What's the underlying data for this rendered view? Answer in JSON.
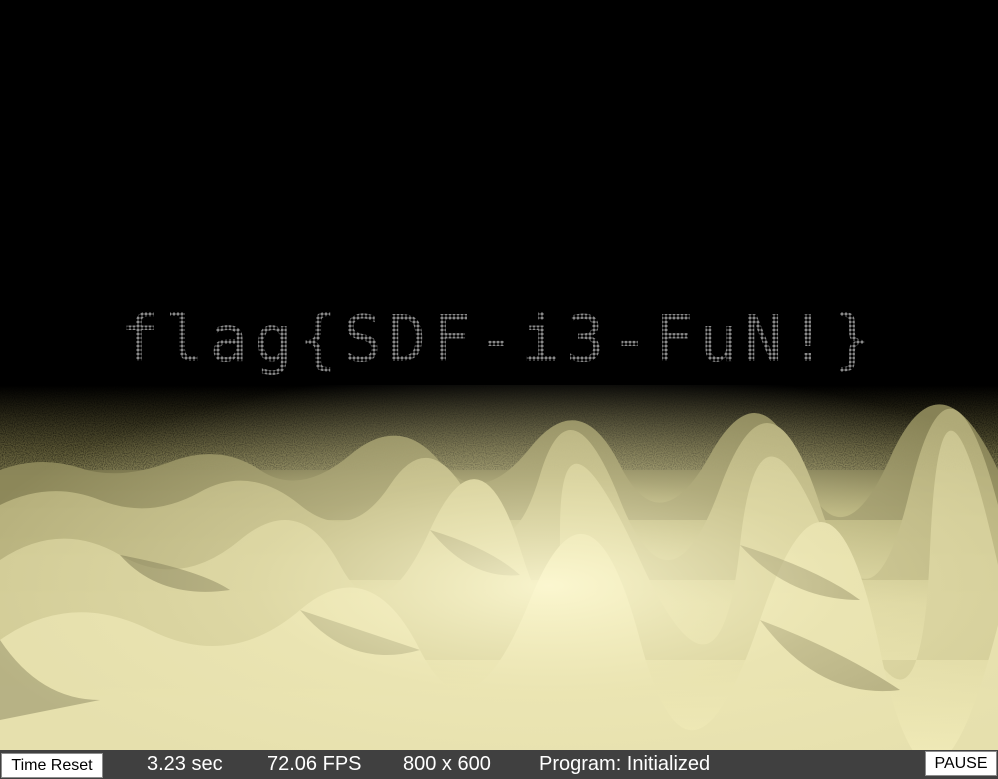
{
  "scene": {
    "overlay_text": "flag{SDF-i3-FuN!}",
    "colors": {
      "background": "#000000",
      "terrain_light": "#fbf5c2",
      "terrain_mid": "#cfc98f",
      "terrain_shadow": "#4a4728",
      "overlay_text": "#8a8a8a",
      "statusbar": "#404040"
    }
  },
  "statusbar": {
    "time_reset_label": "Time Reset",
    "time": "3.23 sec",
    "fps": "72.06 FPS",
    "resolution": "800 x 600",
    "program_status": "Program: Initialized",
    "pause_label": "PAUSE"
  }
}
